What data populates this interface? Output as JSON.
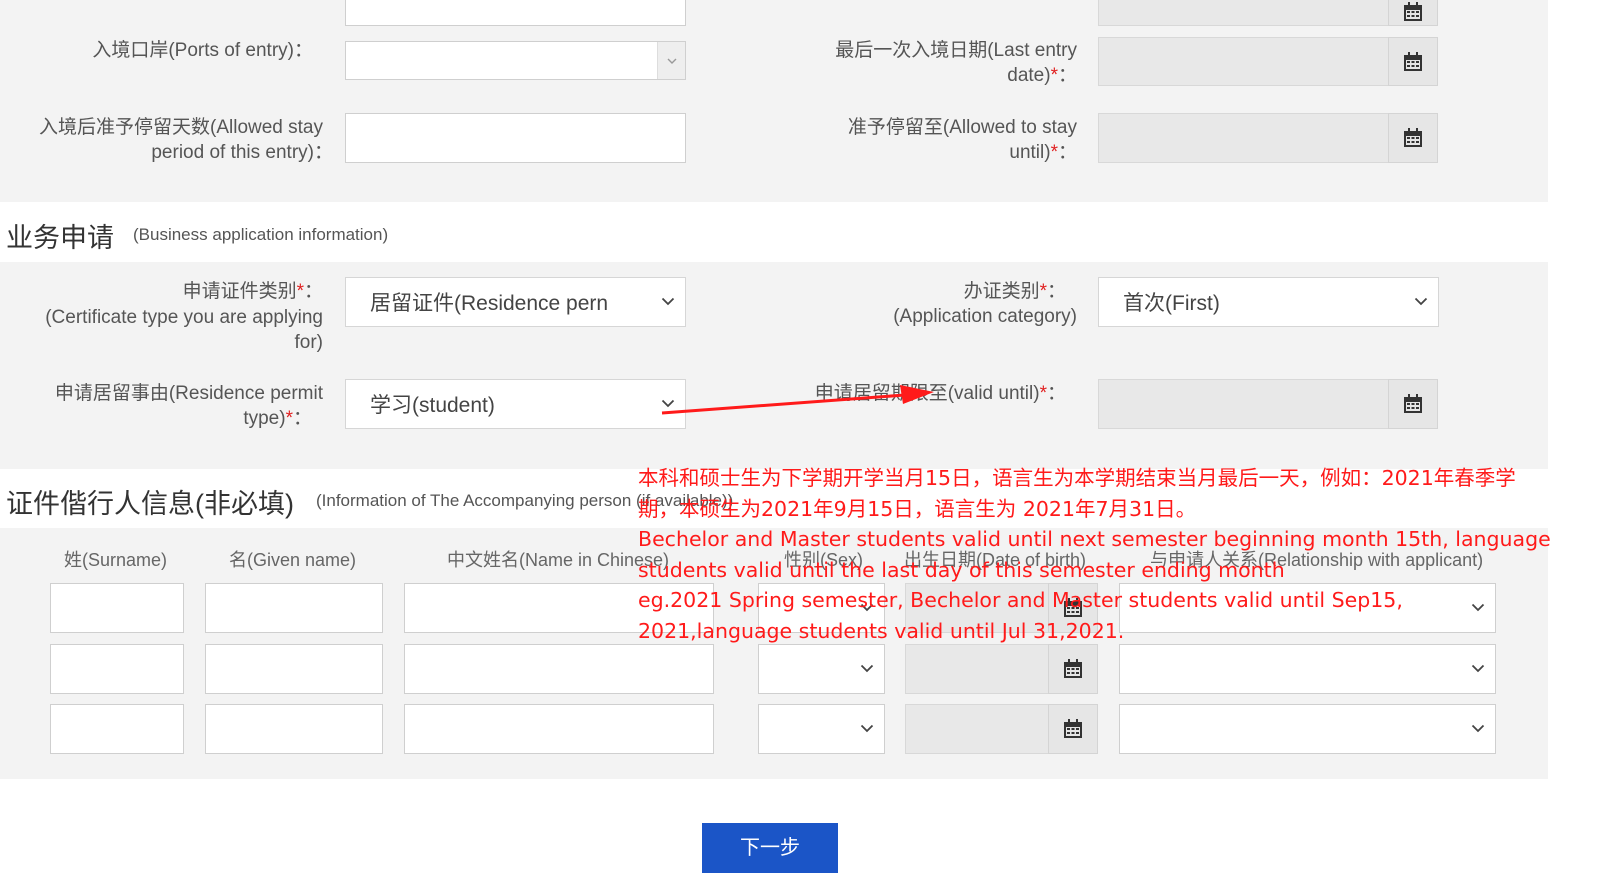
{
  "entry": {
    "ports_of_entry_label": "入境口岸(Ports of entry)：",
    "last_entry_date_label_1": "最后一次入境日期(Last entry",
    "last_entry_date_label_2": "date)",
    "allowed_stay_label_1": "入境后准予停留天数(Allowed stay",
    "allowed_stay_label_2": "period of this entry)：",
    "allowed_until_label_1": "准予停留至(Allowed to stay",
    "allowed_until_label_2": "until)",
    "required_mark": "*",
    "colon": "："
  },
  "business": {
    "title": "业务申请",
    "subtitle": "(Business application information)",
    "cert_type_label_1": "申请证件类别",
    "cert_type_label_2": "(Certificate type you are applying",
    "cert_type_label_3": "for)",
    "cert_type_value": "居留证件(Residence pern",
    "app_category_label_1": "办证类别",
    "app_category_label_2": "(Application category)",
    "app_category_value": "首次(First)",
    "permit_type_label_1": "申请居留事由(Residence permit",
    "permit_type_label_2": "type)",
    "permit_type_value": "学习(student)",
    "valid_until_label": "申请居留期限至(valid until)"
  },
  "accompany": {
    "title": "证件偕行人信息(非必填)",
    "subtitle": "(Information of The Accompanying person (if available))",
    "columns": [
      "姓(Surname)",
      "名(Given name)",
      "中文姓名(Name in Chinese)",
      "性别(Sex)",
      "出生日期(Date of birth)",
      "与申请人关系(Relationship with applicant)"
    ]
  },
  "annotation": {
    "lines": [
      "本科和硕士生为下学期开学当月15日，语言生为本学期结束当月最后一天，例如：2021年春季学",
      "期，本硕生为2021年9月15日，语言生为 2021年7月31日。",
      "Bechelor and Master students valid until next semester beginning month 15th, language",
      "students valid until the last day of this semester ending month",
      "eg.2021 Spring semester, Bechelor and Master students valid until Sep15,",
      "2021,language students valid until Jul 31,2021."
    ],
    "arrow_color": "#ff1a1a"
  },
  "next_button": "下一步"
}
